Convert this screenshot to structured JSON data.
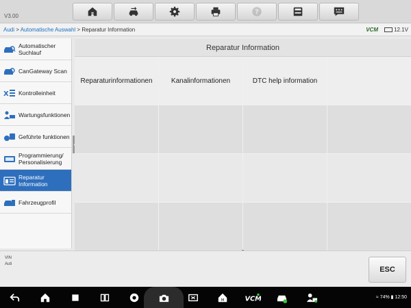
{
  "app": {
    "version": "V3.00"
  },
  "toolbar": {
    "buttons": [
      {
        "icon": "home-icon"
      },
      {
        "icon": "vehicle-swap-icon"
      },
      {
        "icon": "gear-icon"
      },
      {
        "icon": "print-icon"
      },
      {
        "icon": "help-icon"
      },
      {
        "icon": "save-icon"
      },
      {
        "icon": "message-icon"
      }
    ]
  },
  "breadcrumb": {
    "part1": "Audi",
    "sep1": " > ",
    "part2": "Automatische Auswahl",
    "sep2": " > ",
    "part3": "Reparatur Information"
  },
  "status": {
    "vcm": "VCM",
    "voltage": "12.1V"
  },
  "sidebar": {
    "items": [
      {
        "label": "Automatischer Suchlauf",
        "active": false
      },
      {
        "label": "CanGateway Scan",
        "active": false
      },
      {
        "label": "Kontrolleinheit",
        "active": false
      },
      {
        "label": "Wartungsfunktionen",
        "active": false
      },
      {
        "label": "Geführte funktionen",
        "active": false
      },
      {
        "label": "Programmierung/ Personalisierung",
        "active": false
      },
      {
        "label": "Reparatur Information",
        "active": true
      },
      {
        "label": "Fahrzeugprofil",
        "active": false
      }
    ]
  },
  "main": {
    "title": "Reparatur Information",
    "tiles": [
      "Reparaturinformationen",
      "Kanalinformationen",
      "DTC help information",
      "",
      "",
      "",
      "",
      "",
      "",
      "",
      "",
      "",
      "",
      "",
      "",
      ""
    ]
  },
  "footer": {
    "vin_label": "VIN",
    "vehicle": "Auti",
    "esc_label": "ESC"
  },
  "android": {
    "battery": "74%",
    "time": "12:50"
  },
  "colors": {
    "accent": "#2e6fbd",
    "link": "#1b6fc0"
  }
}
